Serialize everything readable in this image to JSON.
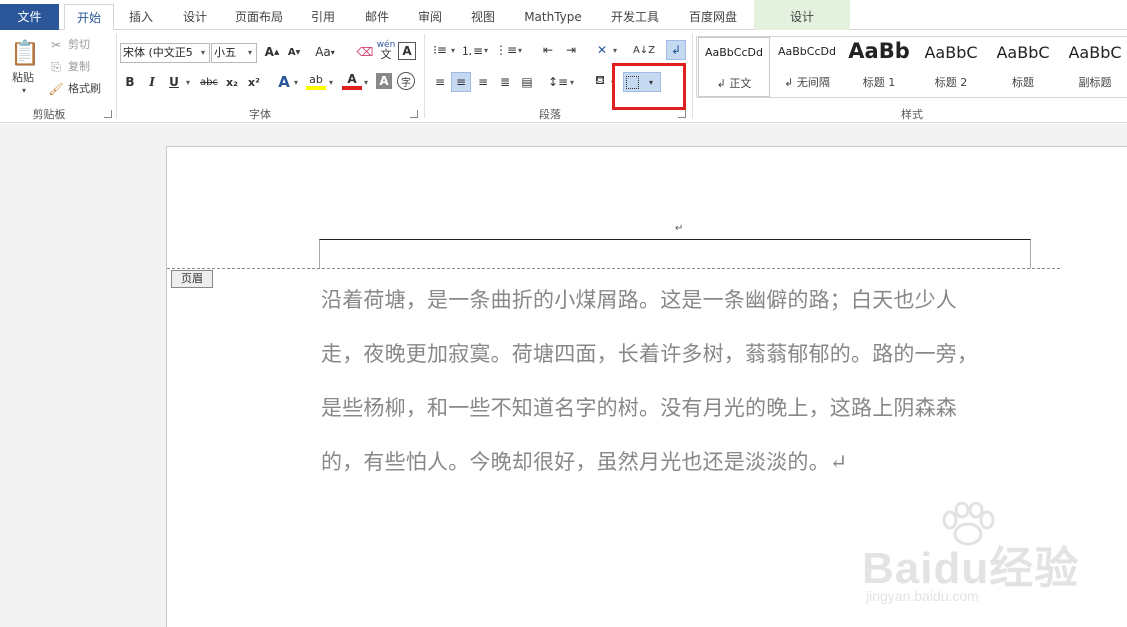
{
  "tabs": [
    {
      "label": "文件"
    },
    {
      "label": "开始"
    },
    {
      "label": "插入"
    },
    {
      "label": "设计"
    },
    {
      "label": "页面布局"
    },
    {
      "label": "引用"
    },
    {
      "label": "邮件"
    },
    {
      "label": "审阅"
    },
    {
      "label": "视图"
    },
    {
      "label": "MathType"
    },
    {
      "label": "开发工具"
    },
    {
      "label": "百度网盘"
    },
    {
      "label": "设计"
    }
  ],
  "clipboard": {
    "paste": "粘贴",
    "cut": "剪切",
    "copy": "复制",
    "format_painter": "格式刷",
    "group": "剪贴板"
  },
  "font": {
    "name": "宋体 (中文正5",
    "size": "小五",
    "group": "字体",
    "bold": "B",
    "italic": "I",
    "underline": "U",
    "strike": "abc",
    "sub": "x₂",
    "sup": "x²",
    "case": "Aa",
    "phonetic": "wén",
    "pinyin_char": "文"
  },
  "paragraph": {
    "group": "段落"
  },
  "styles": {
    "group": "样式",
    "items": [
      {
        "sample": "AaBbCcDd",
        "name": "↲ 正文"
      },
      {
        "sample": "AaBbCcDd",
        "name": "↲ 无间隔"
      },
      {
        "sample": "AaBb",
        "name": "标题 1"
      },
      {
        "sample": "AaBbC",
        "name": "标题 2"
      },
      {
        "sample": "AaBbC",
        "name": "标题"
      },
      {
        "sample": "AaBbC",
        "name": "副标题"
      }
    ]
  },
  "document": {
    "header_label": "页眉",
    "lines": [
      "沿着荷塘，是一条曲折的小煤屑路。这是一条幽僻的路；白天也少人",
      "走，夜晚更加寂寞。荷塘四面，长着许多树，蓊蓊郁郁的。路的一旁，",
      "是些杨柳，和一些不知道名字的树。没有月光的晚上，这路上阴森森",
      "的，有些怕人。今晚却很好，虽然月光也还是淡淡的。↵"
    ]
  },
  "watermark": {
    "brand": "Baidu经验",
    "url": "jingyan.baidu.com"
  },
  "colors": {
    "file_tab": "#2b579a",
    "highlight_box": "#e02020",
    "context_tab": "#e3f1de"
  }
}
